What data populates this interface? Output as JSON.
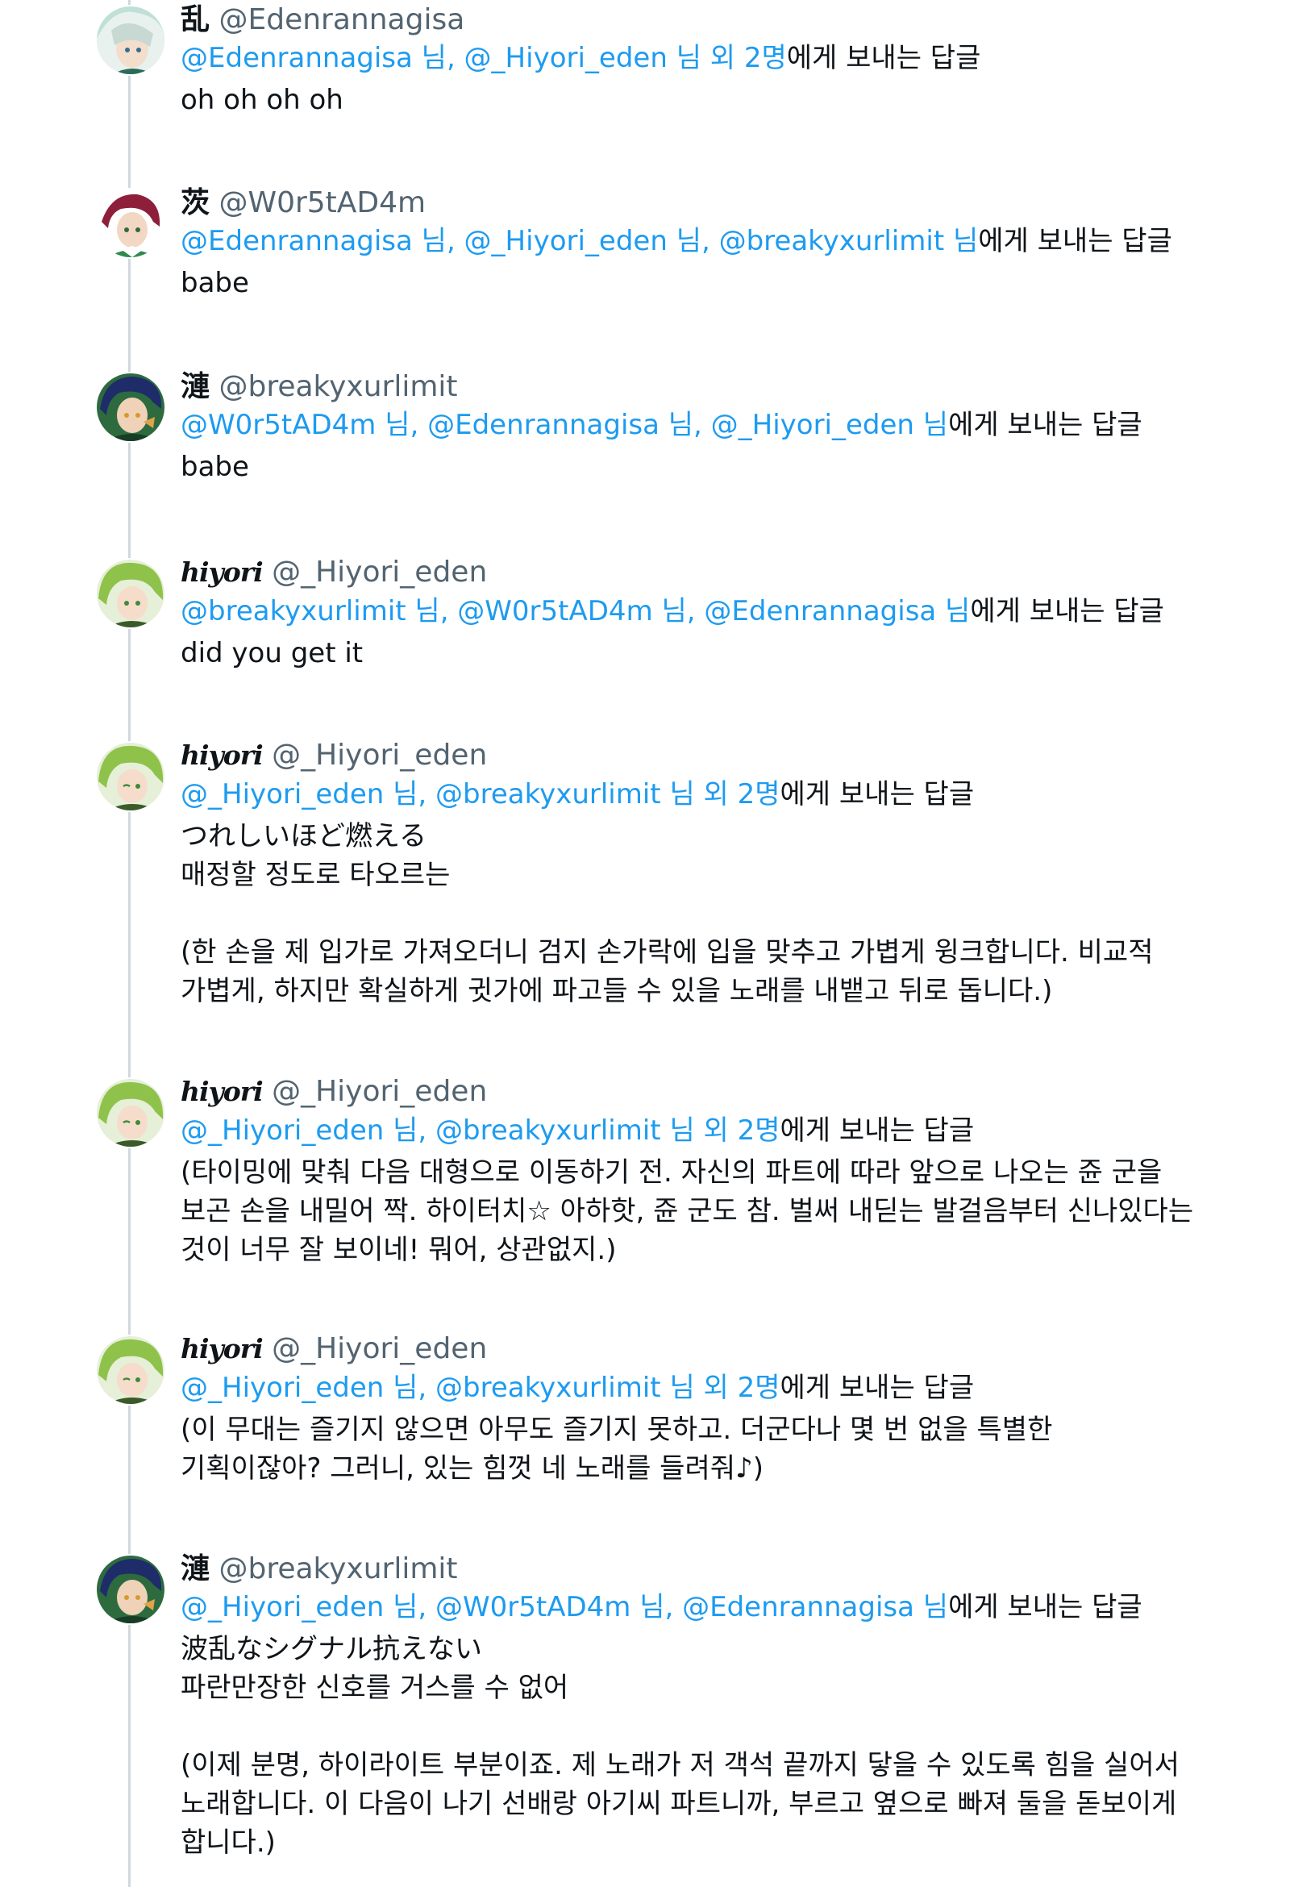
{
  "tweets": [
    {
      "name": "乱",
      "handle": "@Edenrannagisa",
      "mentions": "@Edenrannagisa 님, @_Hiyori_eden 님 외 2명",
      "reply_suffix": "에게 보내는 답글",
      "text": "oh oh oh oh",
      "avatar": "nagisa-avatar"
    },
    {
      "name": "茨",
      "handle": "@W0r5tAD4m",
      "mentions": "@Edenrannagisa 님, @_Hiyori_eden 님, @breakyxurlimit 님",
      "reply_suffix": "에게 보내는 답글",
      "text": "babe",
      "avatar": "ibara-avatar"
    },
    {
      "name": "漣",
      "handle": "@breakyxurlimit",
      "mentions": "@W0r5tAD4m 님, @Edenrannagisa 님, @_Hiyori_eden 님",
      "reply_suffix": "에게 보내는 답글",
      "text": "babe",
      "avatar": "jun-avatar"
    },
    {
      "name": "hiyori",
      "handle": "@_Hiyori_eden",
      "mentions": "@breakyxurlimit 님, @W0r5tAD4m 님, @Edenrannagisa 님",
      "reply_suffix": "에게 보내는 답글",
      "text": "did you get it",
      "avatar": "hiyori-avatar"
    },
    {
      "name": "hiyori",
      "handle": "@_Hiyori_eden",
      "mentions": "@_Hiyori_eden 님, @breakyxurlimit 님 외 2명",
      "reply_suffix": "에게 보내는 답글",
      "text": "つれしいほど燃える\n매정할 정도로 타오르는\n\n(한 손을 제 입가로 가져오더니 검지 손가락에 입을 맞추고 가볍게 윙크합니다. 비교적\n가볍게, 하지만 확실하게 귓가에 파고들 수 있을 노래를 내뱉고 뒤로 돕니다.)",
      "avatar": "hiyori-avatar"
    },
    {
      "name": "hiyori",
      "handle": "@_Hiyori_eden",
      "mentions": "@_Hiyori_eden 님, @breakyxurlimit 님 외 2명",
      "reply_suffix": "에게 보내는 답글",
      "text": "(타이밍에 맞춰 다음 대형으로 이동하기 전. 자신의 파트에 따라 앞으로 나오는 쥰 군을\n보곤 손을 내밀어 짝. 하이터치☆ 아하핫, 쥰 군도 참. 벌써 내딛는 발걸음부터 신나있다는\n것이 너무 잘 보이네! 뭐어, 상관없지.)",
      "avatar": "hiyori-avatar"
    },
    {
      "name": "hiyori",
      "handle": "@_Hiyori_eden",
      "mentions": "@_Hiyori_eden 님, @breakyxurlimit 님 외 2명",
      "reply_suffix": "에게 보내는 답글",
      "text": "(이 무대는 즐기지 않으면 아무도 즐기지 못하고. 더군다나 몇 번 없을 특별한\n기획이잖아? 그러니, 있는 힘껏 네 노래를 들려줘♪)",
      "avatar": "hiyori-avatar"
    },
    {
      "name": "漣",
      "handle": "@breakyxurlimit",
      "mentions": "@_Hiyori_eden 님, @W0r5tAD4m 님, @Edenrannagisa 님",
      "reply_suffix": "에게 보내는 답글",
      "text": "波乱なシグナル抗えない\n파란만장한 신호를 거스를 수 없어\n\n(이제 분명, 하이라이트 부분이죠. 제 노래가 저 객석 끝까지 닿을 수 있도록 힘을 실어서\n노래합니다. 이 다음이 나기 선배랑 아기씨 파트니까, 부르고 옆으로 빠져 둘을 돋보이게\n합니다.)",
      "avatar": "jun-avatar"
    }
  ]
}
